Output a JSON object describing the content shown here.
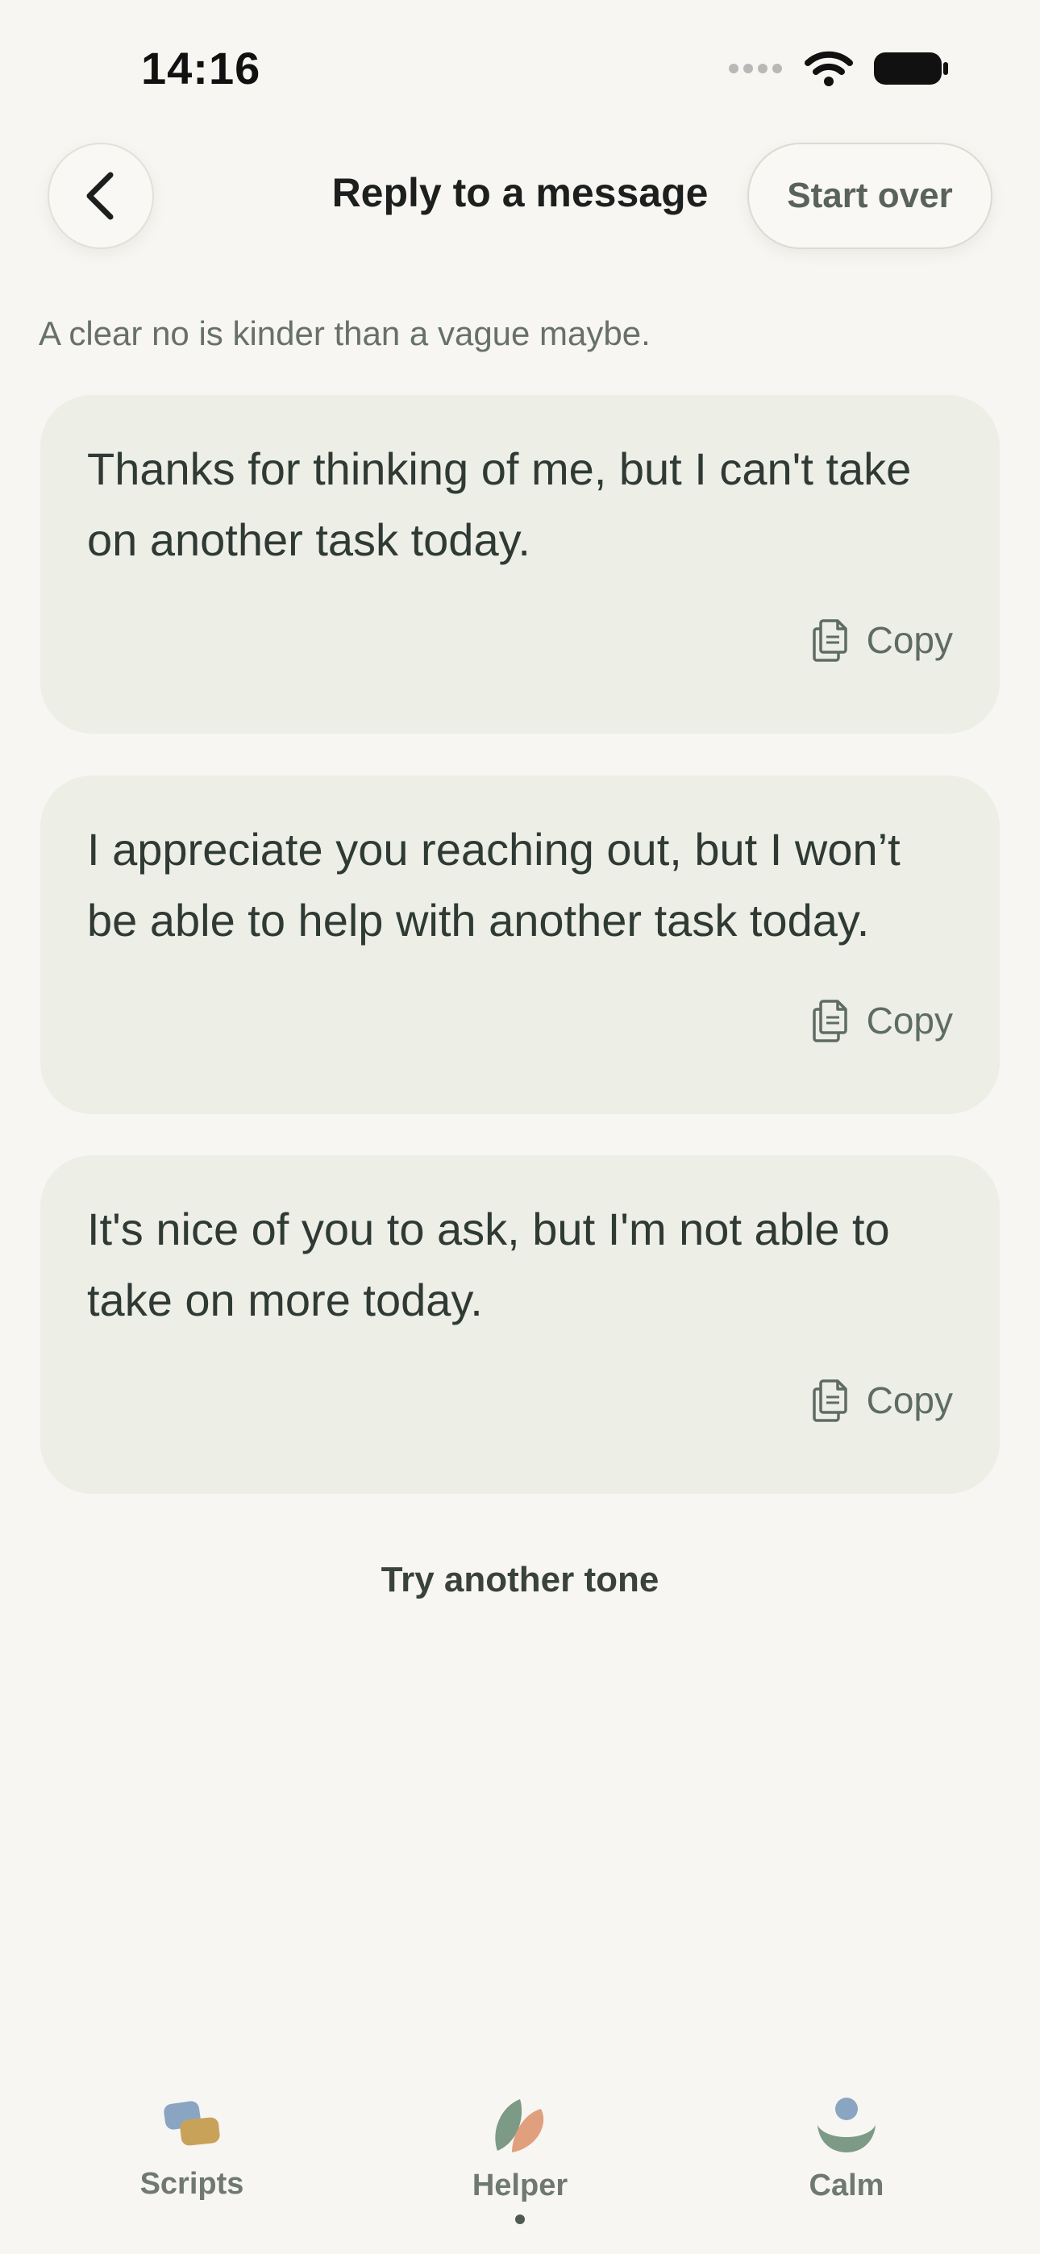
{
  "status": {
    "time": "14:16"
  },
  "header": {
    "title": "Reply to a message",
    "start_over_label": "Start over"
  },
  "subtitle": "A clear no is kinder than a vague maybe.",
  "replies": [
    {
      "text": "Thanks for thinking of me, but I can't take on another task today.",
      "copy_label": "Copy"
    },
    {
      "text": "I appreciate you reaching out, but I won’t be able to help with another task today.",
      "copy_label": "Copy"
    },
    {
      "text": "It's nice of you to ask, but I'm not able to take on more today.",
      "copy_label": "Copy"
    }
  ],
  "try_another_tone_label": "Try another tone",
  "tabs": [
    {
      "label": "Scripts",
      "icon": "scripts-icon",
      "active": false
    },
    {
      "label": "Helper",
      "icon": "helper-icon",
      "active": true
    },
    {
      "label": "Calm",
      "icon": "calm-icon",
      "active": false
    }
  ],
  "colors": {
    "background": "#f7f6f2",
    "card": "#edeee6",
    "text": "#2f3a34",
    "muted": "#67706b",
    "accent_green": "#7d9a86",
    "accent_blue": "#8aa5c2",
    "accent_gold": "#c9a25a",
    "accent_peach": "#e0a07e"
  }
}
